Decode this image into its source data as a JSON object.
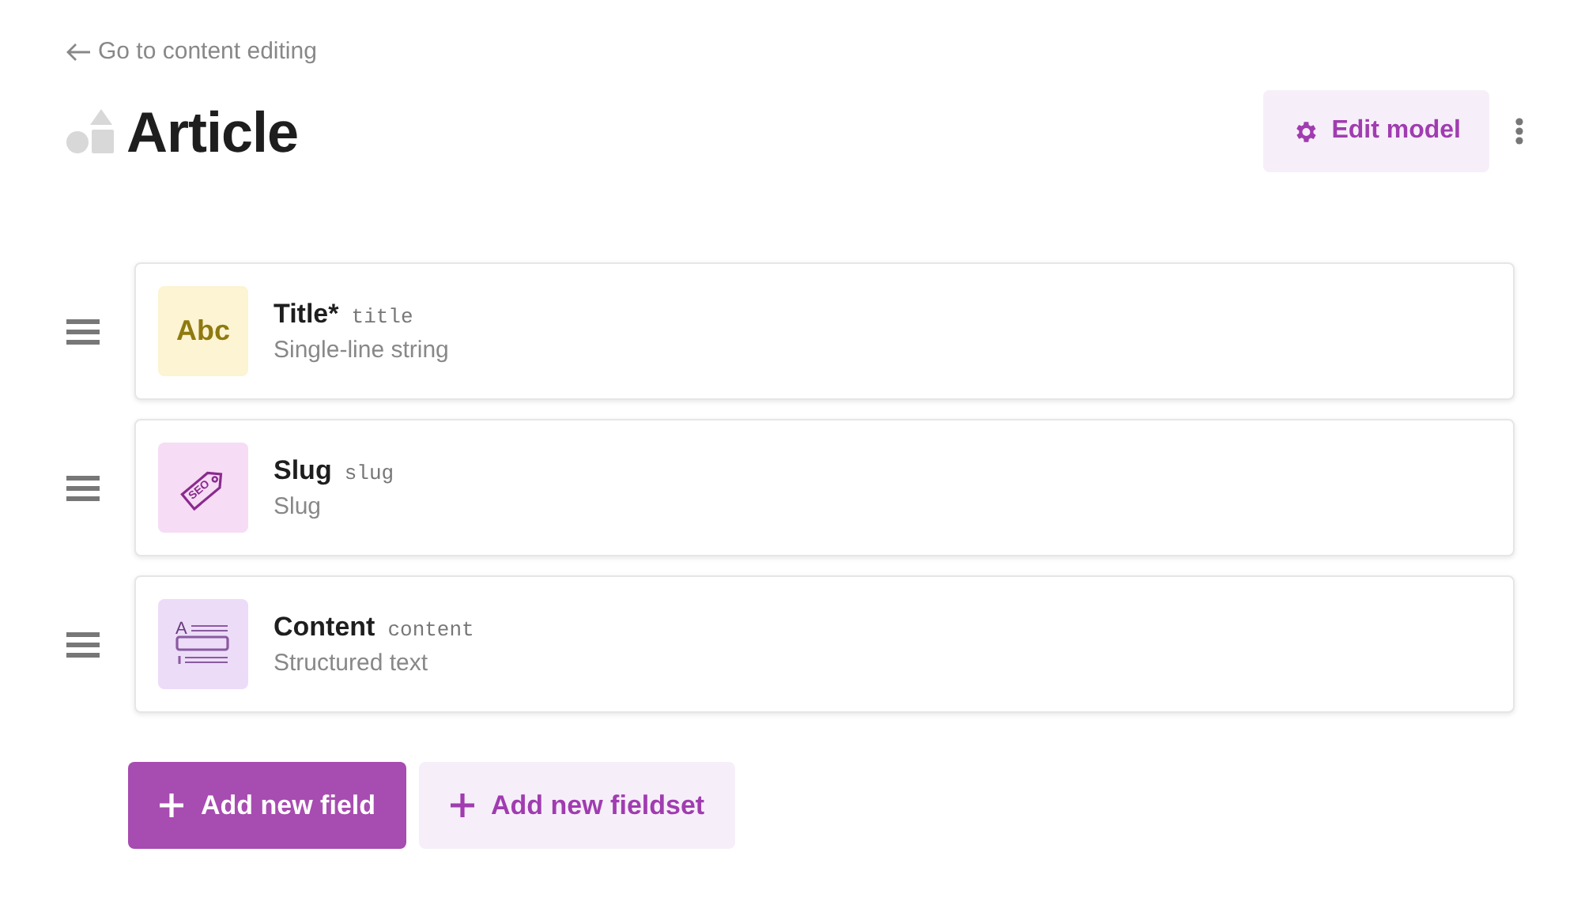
{
  "back_link": "Go to content editing",
  "title": "Article",
  "edit_button": "Edit model",
  "fields": [
    {
      "kind": "string",
      "icon_text": "Abc",
      "label": "Title*",
      "api_key": "title",
      "type": "Single-line string"
    },
    {
      "kind": "slug",
      "icon_text": "SEO",
      "label": "Slug",
      "api_key": "slug",
      "type": "Slug"
    },
    {
      "kind": "structured",
      "icon_text": "A",
      "label": "Content",
      "api_key": "content",
      "type": "Structured text"
    }
  ],
  "buttons": [
    {
      "kind": "primary",
      "label": "Add new field"
    },
    {
      "kind": "secondary",
      "label": "Add new fieldset"
    }
  ]
}
